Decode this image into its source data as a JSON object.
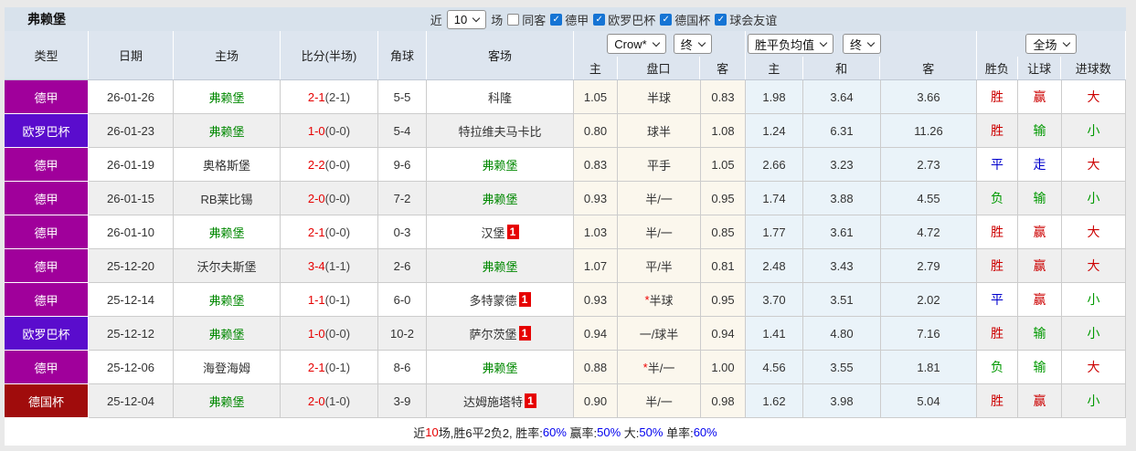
{
  "page": {
    "title": "弗赖堡"
  },
  "toolbar": {
    "near_label": "近",
    "count_select": "10",
    "unit_label": "场",
    "filters": [
      {
        "label": "同客",
        "checked": false
      },
      {
        "label": "德甲",
        "checked": true
      },
      {
        "label": "欧罗巴杯",
        "checked": true
      },
      {
        "label": "德国杯",
        "checked": true
      },
      {
        "label": "球会友谊",
        "checked": true
      }
    ]
  },
  "header": {
    "cols": {
      "type": "类型",
      "date": "日期",
      "home": "主场",
      "score": "比分(半场)",
      "corner": "角球",
      "away": "客场"
    },
    "sub": {
      "h": "主",
      "hc": "盘口",
      "a": "客",
      "avg_h": "主",
      "avg_d": "和",
      "avg_a": "客",
      "wl": "胜负",
      "rang": "让球",
      "goals": "进球数"
    },
    "selects": {
      "company": "Crow*",
      "company_state": "终",
      "avg": "胜平负均值",
      "avg_state": "终",
      "scope": "全场"
    }
  },
  "colors": {
    "league_dejia": "#a0009b",
    "league_europa": "#5a0ccd",
    "league_pokal": "#a00c0c",
    "self_team_green": "#008800",
    "score_red": "#e60000",
    "result_red": "#cc0000",
    "result_blue": "#0000cc",
    "result_green": "#009900",
    "crow_col_bg": "#fbf7ed",
    "avg_col_bg": "#eaf3f9",
    "header_bg": "#dde5ef",
    "titlebar_bg": "#d8e2ec",
    "footer_blue": "#0000ee",
    "checkbox_blue": "#1574d4"
  },
  "rows": [
    {
      "type": "德甲",
      "league": "dejia",
      "date": "26-01-26",
      "home": "弗赖堡",
      "home_v": "self",
      "score": "2-1",
      "half": "(2-1)",
      "corner": "5-5",
      "away": "科隆",
      "away_v": "other",
      "away_badge": "",
      "oh": "1.05",
      "star": "",
      "hc": "半球",
      "oa": "0.83",
      "ah": "1.98",
      "ad": "3.64",
      "aa": "3.66",
      "wl": "胜",
      "wl_v": "red",
      "hr": "赢",
      "hr_v": "red",
      "gl": "大",
      "gl_v": "red"
    },
    {
      "type": "欧罗巴杯",
      "league": "europa",
      "date": "26-01-23",
      "home": "弗赖堡",
      "home_v": "self",
      "score": "1-0",
      "half": "(0-0)",
      "corner": "5-4",
      "away": "特拉维夫马卡比",
      "away_v": "other",
      "away_badge": "",
      "oh": "0.80",
      "star": "",
      "hc": "球半",
      "oa": "1.08",
      "ah": "1.24",
      "ad": "6.31",
      "aa": "11.26",
      "wl": "胜",
      "wl_v": "red",
      "hr": "输",
      "hr_v": "green",
      "gl": "小",
      "gl_v": "green"
    },
    {
      "type": "德甲",
      "league": "dejia",
      "date": "26-01-19",
      "home": "奥格斯堡",
      "home_v": "other",
      "score": "2-2",
      "half": "(0-0)",
      "corner": "9-6",
      "away": "弗赖堡",
      "away_v": "self",
      "away_badge": "",
      "oh": "0.83",
      "star": "",
      "hc": "平手",
      "oa": "1.05",
      "ah": "2.66",
      "ad": "3.23",
      "aa": "2.73",
      "wl": "平",
      "wl_v": "blue",
      "hr": "走",
      "hr_v": "blue",
      "gl": "大",
      "gl_v": "red"
    },
    {
      "type": "德甲",
      "league": "dejia",
      "date": "26-01-15",
      "home": "RB莱比锡",
      "home_v": "other",
      "score": "2-0",
      "half": "(0-0)",
      "corner": "7-2",
      "away": "弗赖堡",
      "away_v": "self",
      "away_badge": "",
      "oh": "0.93",
      "star": "",
      "hc": "半/一",
      "oa": "0.95",
      "ah": "1.74",
      "ad": "3.88",
      "aa": "4.55",
      "wl": "负",
      "wl_v": "green",
      "hr": "输",
      "hr_v": "green",
      "gl": "小",
      "gl_v": "green"
    },
    {
      "type": "德甲",
      "league": "dejia",
      "date": "26-01-10",
      "home": "弗赖堡",
      "home_v": "self",
      "score": "2-1",
      "half": "(0-0)",
      "corner": "0-3",
      "away": "汉堡",
      "away_v": "other",
      "away_badge": "1",
      "oh": "1.03",
      "star": "",
      "hc": "半/一",
      "oa": "0.85",
      "ah": "1.77",
      "ad": "3.61",
      "aa": "4.72",
      "wl": "胜",
      "wl_v": "red",
      "hr": "赢",
      "hr_v": "red",
      "gl": "大",
      "gl_v": "red"
    },
    {
      "type": "德甲",
      "league": "dejia",
      "date": "25-12-20",
      "home": "沃尔夫斯堡",
      "home_v": "other",
      "score": "3-4",
      "half": "(1-1)",
      "corner": "2-6",
      "away": "弗赖堡",
      "away_v": "self",
      "away_badge": "",
      "oh": "1.07",
      "star": "",
      "hc": "平/半",
      "oa": "0.81",
      "ah": "2.48",
      "ad": "3.43",
      "aa": "2.79",
      "wl": "胜",
      "wl_v": "red",
      "hr": "赢",
      "hr_v": "red",
      "gl": "大",
      "gl_v": "red"
    },
    {
      "type": "德甲",
      "league": "dejia",
      "date": "25-12-14",
      "home": "弗赖堡",
      "home_v": "self",
      "score": "1-1",
      "half": "(0-1)",
      "corner": "6-0",
      "away": "多特蒙德",
      "away_v": "other",
      "away_badge": "1",
      "oh": "0.93",
      "star": "*",
      "hc": "半球",
      "oa": "0.95",
      "ah": "3.70",
      "ad": "3.51",
      "aa": "2.02",
      "wl": "平",
      "wl_v": "blue",
      "hr": "赢",
      "hr_v": "red",
      "gl": "小",
      "gl_v": "green"
    },
    {
      "type": "欧罗巴杯",
      "league": "europa",
      "date": "25-12-12",
      "home": "弗赖堡",
      "home_v": "self",
      "score": "1-0",
      "half": "(0-0)",
      "corner": "10-2",
      "away": "萨尔茨堡",
      "away_v": "other",
      "away_badge": "1",
      "oh": "0.94",
      "star": "",
      "hc": "一/球半",
      "oa": "0.94",
      "ah": "1.41",
      "ad": "4.80",
      "aa": "7.16",
      "wl": "胜",
      "wl_v": "red",
      "hr": "输",
      "hr_v": "green",
      "gl": "小",
      "gl_v": "green"
    },
    {
      "type": "德甲",
      "league": "dejia",
      "date": "25-12-06",
      "home": "海登海姆",
      "home_v": "other",
      "score": "2-1",
      "half": "(0-1)",
      "corner": "8-6",
      "away": "弗赖堡",
      "away_v": "self",
      "away_badge": "",
      "oh": "0.88",
      "star": "*",
      "hc": "半/一",
      "oa": "1.00",
      "ah": "4.56",
      "ad": "3.55",
      "aa": "1.81",
      "wl": "负",
      "wl_v": "green",
      "hr": "输",
      "hr_v": "green",
      "gl": "大",
      "gl_v": "red"
    },
    {
      "type": "德国杯",
      "league": "pokal",
      "date": "25-12-04",
      "home": "弗赖堡",
      "home_v": "self",
      "score": "2-0",
      "half": "(1-0)",
      "corner": "3-9",
      "away": "达姆施塔特",
      "away_v": "other",
      "away_badge": "1",
      "oh": "0.90",
      "star": "",
      "hc": "半/一",
      "oa": "0.98",
      "ah": "1.62",
      "ad": "3.98",
      "aa": "5.04",
      "wl": "胜",
      "wl_v": "red",
      "hr": "赢",
      "hr_v": "red",
      "gl": "小",
      "gl_v": "green"
    }
  ],
  "footer": {
    "p1": "近",
    "n": "10",
    "p2": "场,胜6平2负2, 胜率:",
    "v1": "60%",
    "p3": " 赢率:",
    "v2": "50%",
    "p4": " 大:",
    "v3": "50%",
    "p5": " 单率:",
    "v4": "60%"
  }
}
